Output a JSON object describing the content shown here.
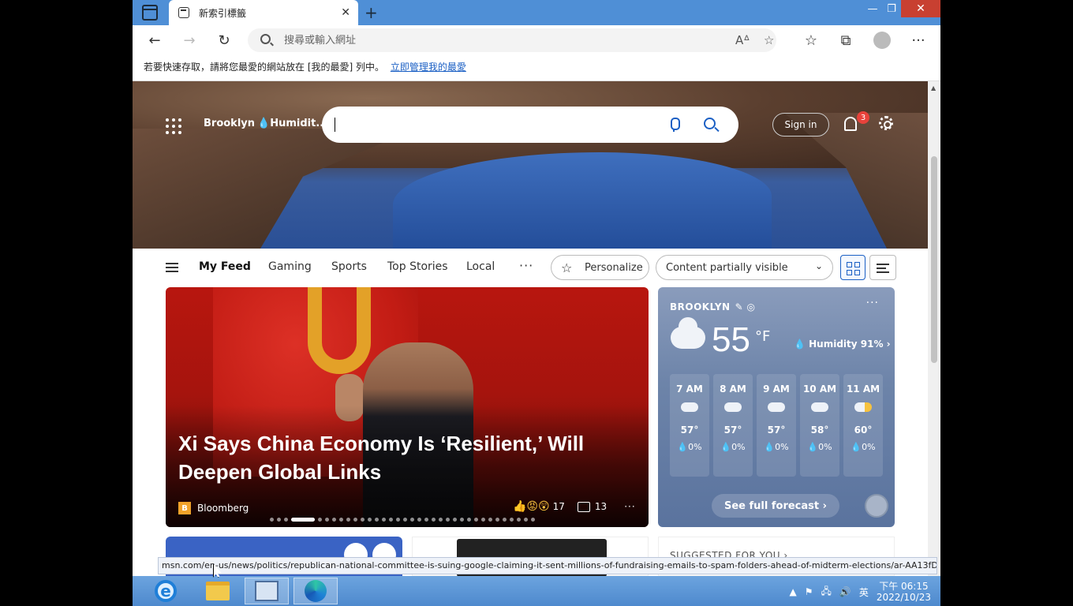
{
  "browser": {
    "tab_title": "新索引標籤",
    "address_placeholder": "搜尋或輸入網址",
    "favorites_prompt": "若要快速存取，請將您最愛的網站放在 [我的最愛] 列中。",
    "favorites_link": "立即管理我的最愛"
  },
  "msn_header": {
    "location": "Brooklyn",
    "humidity_short": "Humidit...",
    "sign_in": "Sign in",
    "notification_count": "3"
  },
  "feed_nav": {
    "tabs": [
      "My Feed",
      "Gaming",
      "Sports",
      "Top Stories",
      "Local"
    ],
    "more": "···",
    "personalize": "Personalize",
    "content_visibility": "Content partially visible"
  },
  "hero_story": {
    "headline": "Xi Says China Economy Is ‘Resilient,’ Will Deepen Global Links",
    "source": "Bloomberg",
    "reactions": "17",
    "comments": "13",
    "more": "···"
  },
  "weather": {
    "location": "BROOKLYN",
    "temp": "55",
    "unit": "°F",
    "humidity": "Humidity 91%",
    "hourly": [
      {
        "time": "7 AM",
        "temp": "57°",
        "precip": "0%"
      },
      {
        "time": "8 AM",
        "temp": "57°",
        "precip": "0%"
      },
      {
        "time": "9 AM",
        "temp": "57°",
        "precip": "0%"
      },
      {
        "time": "10 AM",
        "temp": "58°",
        "precip": "0%"
      },
      {
        "time": "11 AM",
        "temp": "60°",
        "precip": "0%"
      }
    ],
    "forecast_link": "See full forecast"
  },
  "lower_cards": {
    "suggested": "SUGGESTED FOR YOU"
  },
  "status_url": "msn.com/en-us/news/politics/republican-national-committee-is-suing-google-claiming-it-sent-millions-of-fundraising-emails-to-spam-folders-ahead-of-midterm-elections/ar-AA13fD...",
  "taskbar": {
    "ime": "英",
    "time": "下午 06:15",
    "date": "2022/10/23"
  },
  "colors": {
    "accent": "#1a5fc4",
    "titlebar": "#4f8fd6",
    "close": "#c84031"
  }
}
